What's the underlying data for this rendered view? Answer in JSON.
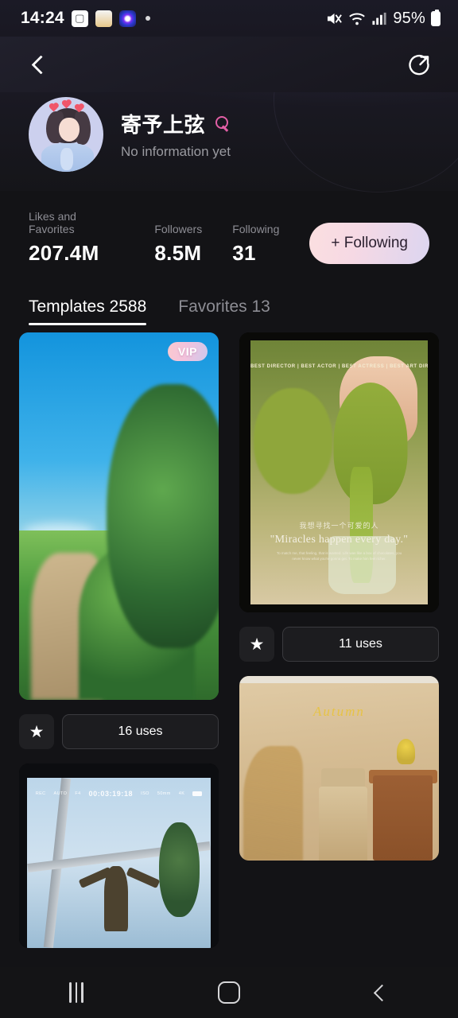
{
  "status_bar": {
    "time": "14:24",
    "icons": [
      "photos-icon",
      "sticker-app-icon",
      "camera-app-icon",
      "dot-indicator"
    ],
    "mute_icon": "mute-icon",
    "wifi_icon": "wifi-icon",
    "signal_icon": "cellular-signal-icon",
    "battery_percent": "95%"
  },
  "topbar": {
    "back_icon": "back-chevron-icon",
    "share_icon": "share-icon"
  },
  "profile": {
    "avatar_alt": "user-avatar",
    "name": "寄予上弦",
    "gender_icon": "female-gender-icon",
    "bio": "No information yet",
    "stats": [
      {
        "label": "Likes and Favorites",
        "value": "207.4M"
      },
      {
        "label": "Followers",
        "value": "8.5M"
      },
      {
        "label": "Following",
        "value": "31"
      }
    ],
    "follow_button": "+ Following"
  },
  "tabs": [
    {
      "label": "Templates 2588",
      "active": true
    },
    {
      "label": "Favorites 13",
      "active": false
    }
  ],
  "cards": {
    "left": [
      {
        "id": "template-landscape",
        "badge": "VIP",
        "star_icon": "star-icon",
        "uses": "16 uses"
      },
      {
        "id": "template-viewfinder",
        "hud_timecode": "00:03:19:18",
        "hud_left": [
          "REC",
          "AUTO",
          "F4"
        ],
        "hud_right": [
          "ISO",
          "50mm",
          "4K"
        ]
      }
    ],
    "right": [
      {
        "id": "template-matcha",
        "awards": "BEST DIRECTOR  |  BEST ACTOR  |  BEST ACTRESS  |  BEST ART DIRECTION",
        "caption_cn": "我想寻找一个可爱的人",
        "caption_en": "\"Miracles happen every day.\"",
        "caption_small": "To match me, that feeling, that is wanted. Life was like a box of chocolates, you never know what you're gonna get. To make him feel richer.",
        "star_icon": "star-icon",
        "uses": "11 uses"
      },
      {
        "id": "template-autumn",
        "script_text": "Autumn"
      }
    ]
  },
  "navbar": {
    "recents_icon": "recents-icon",
    "home_icon": "home-icon",
    "back_icon": "back-icon"
  },
  "colors": {
    "background": "#131316",
    "accent_pink": "#f6d9e4",
    "accent_lavender": "#dcd5f0",
    "gender_pink": "#e25fa6"
  }
}
